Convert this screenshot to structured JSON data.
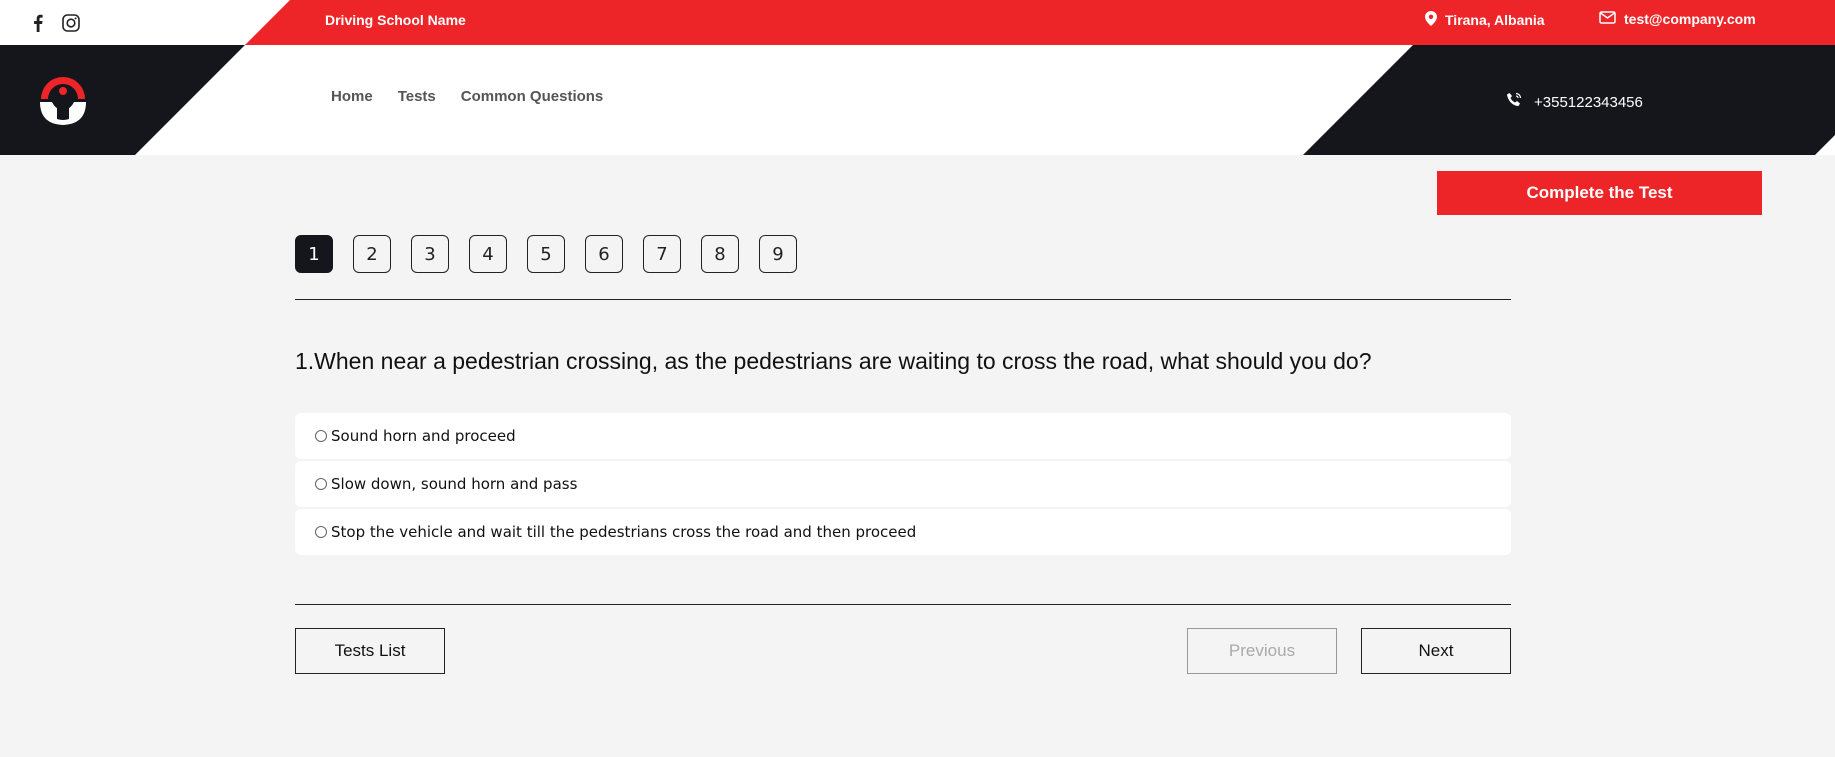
{
  "topbar": {
    "school_name": "Driving School Name",
    "location": "Tirana, Albania",
    "email": "test@company.com",
    "social": [
      "facebook-icon",
      "instagram-icon"
    ]
  },
  "header": {
    "nav": [
      "Home",
      "Tests",
      "Common Questions"
    ],
    "phone": "+355122343456"
  },
  "test": {
    "complete_label": "Complete the Test",
    "pages": [
      "1",
      "2",
      "3",
      "4",
      "5",
      "6",
      "7",
      "8",
      "9"
    ],
    "active_page": "1",
    "question": "1.When near a pedestrian crossing, as the pedestrians are waiting to cross the road, what should you do?",
    "options": [
      "Sound horn and proceed",
      "Slow down, sound horn and pass",
      "Stop the vehicle and wait till the pedestrians cross the road and then proceed"
    ],
    "tests_list_label": "Tests List",
    "previous_label": "Previous",
    "next_label": "Next"
  },
  "colors": {
    "brand_red": "#ee2528",
    "dark": "#15151c",
    "background": "#f4f4f4"
  }
}
